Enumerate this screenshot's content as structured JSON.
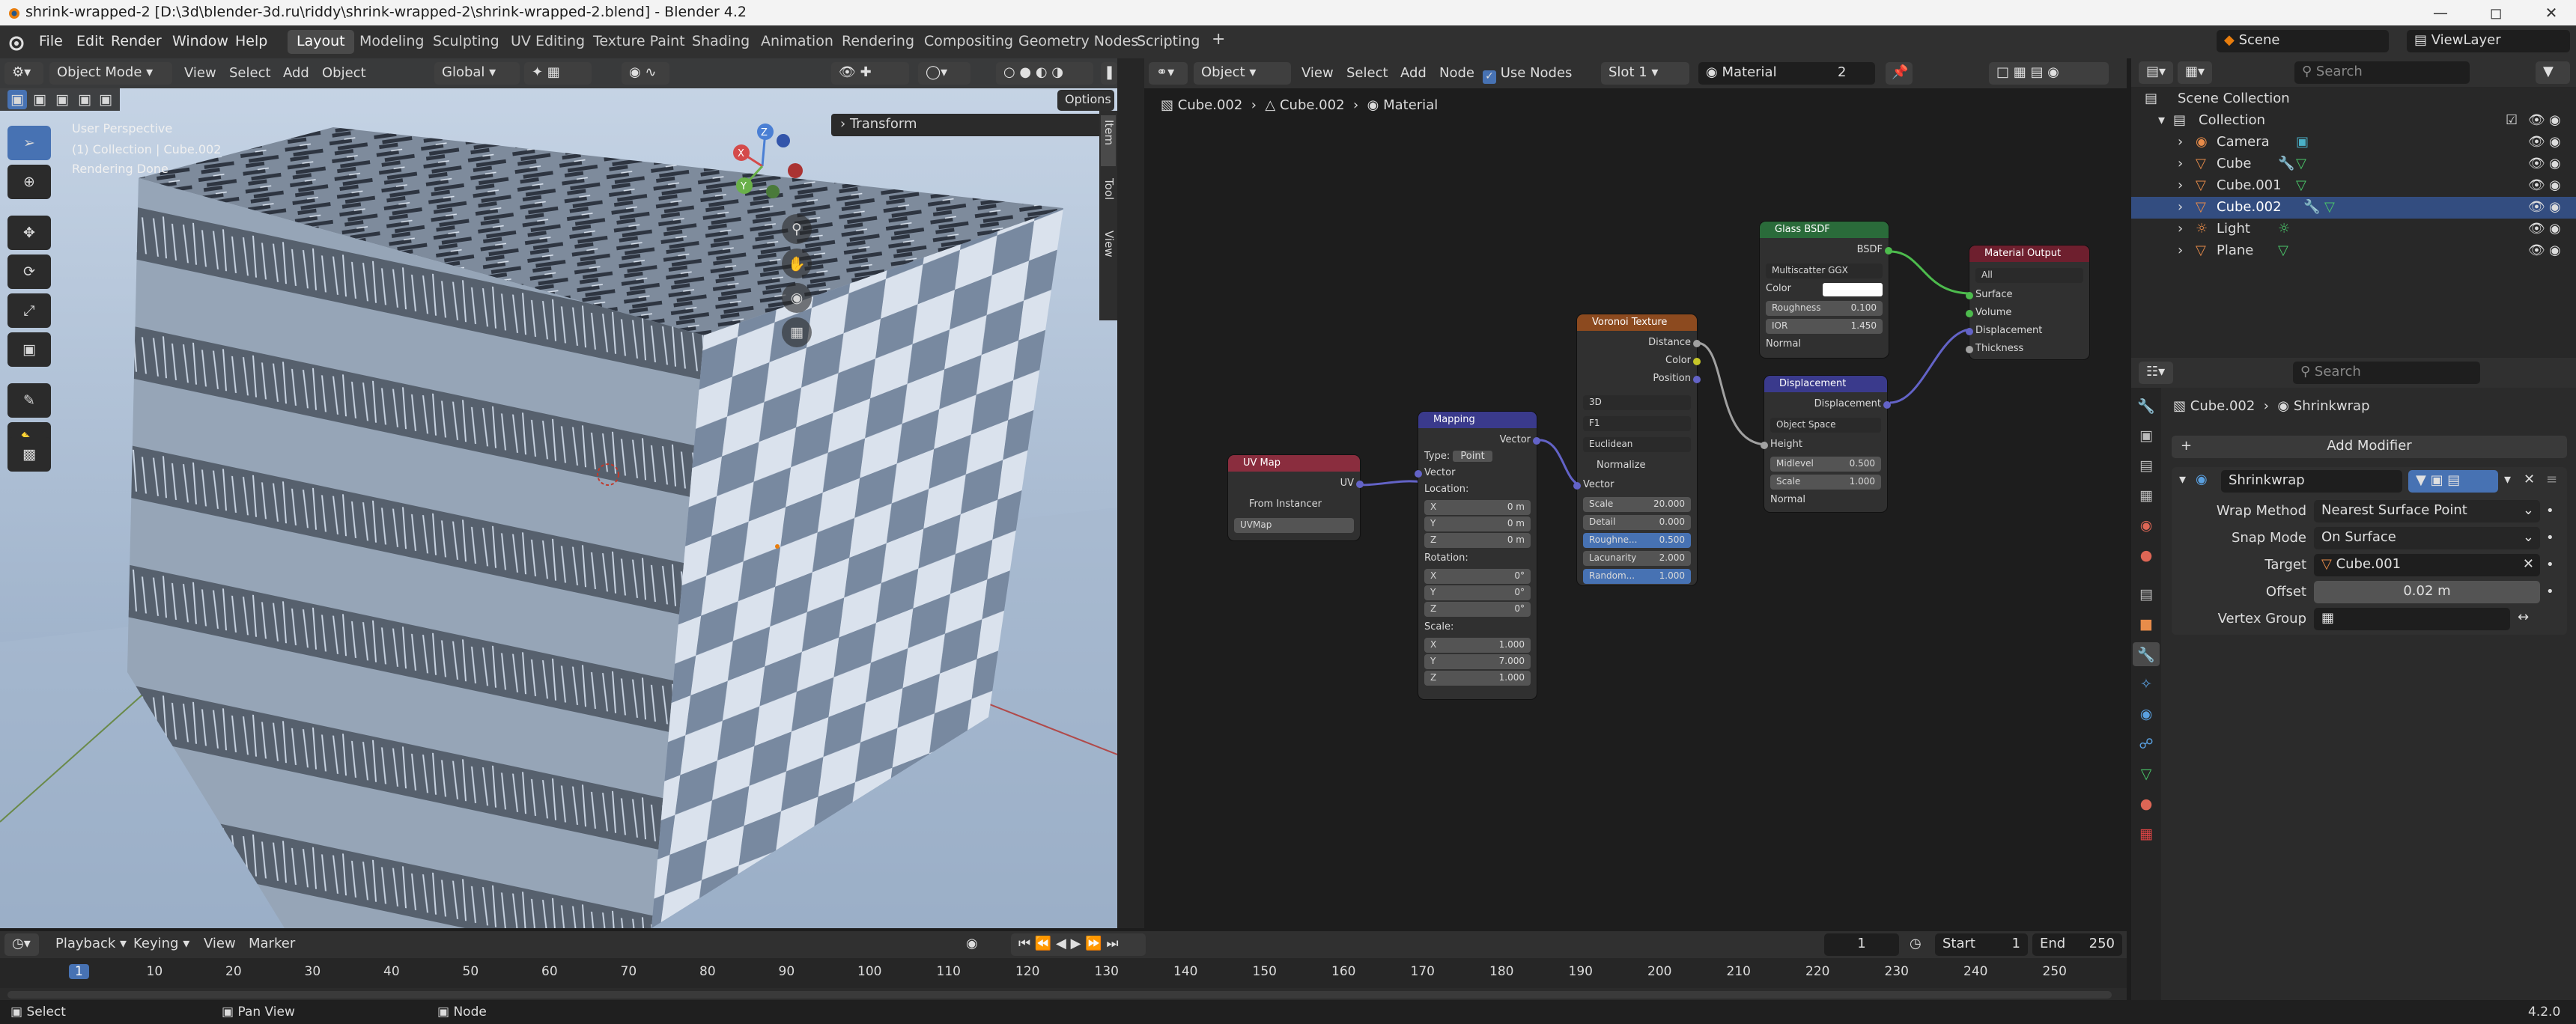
{
  "title": "shrink-wrapped-2 [D:\\3d\\blender-3d.ru\\riddy\\shrink-wrapped-2\\shrink-wrapped-2.blend] - Blender 4.2",
  "menus": [
    "File",
    "Edit",
    "Render",
    "Window",
    "Help"
  ],
  "workspaces": [
    "Layout",
    "Modeling",
    "Sculpting",
    "UV Editing",
    "Texture Paint",
    "Shading",
    "Animation",
    "Rendering",
    "Compositing",
    "Geometry Nodes",
    "Scripting"
  ],
  "scene": "Scene",
  "view_layer": "ViewLayer",
  "viewport": {
    "mode": "Object Mode",
    "menus": [
      "View",
      "Select",
      "Add",
      "Object"
    ],
    "orientation": "Global",
    "options": "Options",
    "transform": "Transform",
    "overlay_lines": [
      "User Perspective",
      "(1) Collection | Cube.002",
      "Rendering Done"
    ],
    "side_tabs": [
      "Item",
      "Tool",
      "View"
    ],
    "gizmo": {
      "x": "X",
      "y": "Y",
      "z": "Z"
    }
  },
  "node_editor": {
    "type": "Object",
    "menus": [
      "View",
      "Select",
      "Add",
      "Node"
    ],
    "use_nodes": "Use Nodes",
    "slot": "Slot 1",
    "material": "Material",
    "users": "2",
    "breadcrumb": [
      "Cube.002",
      "Cube.002",
      "Material"
    ],
    "nodes": {
      "uvmap": {
        "title": "UV Map",
        "out": "UV",
        "from_instancer": "From Instancer",
        "uvmap": "UVMap"
      },
      "mapping": {
        "title": "Mapping",
        "out": "Vector",
        "type_label": "Type:",
        "type": "Point",
        "vector": "Vector",
        "location": "Location:",
        "loc": [
          [
            "X",
            "0 m"
          ],
          [
            "Y",
            "0 m"
          ],
          [
            "Z",
            "0 m"
          ]
        ],
        "rotation": "Rotation:",
        "rot": [
          [
            "X",
            "0°"
          ],
          [
            "Y",
            "0°"
          ],
          [
            "Z",
            "0°"
          ]
        ],
        "scale": "Scale:",
        "scl": [
          [
            "X",
            "1.000"
          ],
          [
            "Y",
            "7.000"
          ],
          [
            "Z",
            "1.000"
          ]
        ]
      },
      "voronoi": {
        "title": "Voronoi Texture",
        "outs": [
          "Distance",
          "Color",
          "Position"
        ],
        "dim": "3D",
        "feature": "F1",
        "metric": "Euclidean",
        "normalize": "Normalize",
        "vector": "Vector",
        "fields": [
          [
            "Scale",
            "20.000"
          ],
          [
            "Detail",
            "0.000"
          ],
          [
            "Roughne...",
            "0.500"
          ],
          [
            "Lacunarity",
            "2.000"
          ],
          [
            "Random...",
            "1.000"
          ]
        ]
      },
      "glass": {
        "title": "Glass BSDF",
        "out": "BSDF",
        "dist": "Multiscatter GGX",
        "color": "Color",
        "roughness": [
          "Roughness",
          "0.100"
        ],
        "ior": [
          "IOR",
          "1.450"
        ],
        "normal": "Normal"
      },
      "disp": {
        "title": "Displacement",
        "out": "Displacement",
        "space": "Object Space",
        "height": "Height",
        "midlevel": [
          "Midlevel",
          "0.500"
        ],
        "scale": [
          "Scale",
          "1.000"
        ],
        "normal": "Normal"
      },
      "output": {
        "title": "Material Output",
        "target": "All",
        "ins": [
          "Surface",
          "Volume",
          "Displacement",
          "Thickness"
        ]
      }
    },
    "colors": {
      "uvmap": "#8a2d3e",
      "mapping": "#3a3a8c",
      "voronoi": "#8c4a1f",
      "glass": "#2a6b3a",
      "disp": "#3a3a8c",
      "output": "#6e1f2e"
    }
  },
  "outliner": {
    "search": "Search",
    "rows": [
      "Scene Collection",
      "Collection",
      "Camera",
      "Cube",
      "Cube.001",
      "Cube.002",
      "Light",
      "Plane"
    ]
  },
  "properties": {
    "search": "Search",
    "breadcrumb": [
      "Cube.002",
      "Shrinkwrap"
    ],
    "add_modifier": "Add Modifier",
    "modifier": "Shrinkwrap",
    "fields": [
      [
        "Wrap Method",
        "Nearest Surface Point"
      ],
      [
        "Snap Mode",
        "On Surface"
      ],
      [
        "Target",
        "Cube.001"
      ],
      [
        "Offset",
        "0.02 m"
      ],
      [
        "Vertex Group",
        ""
      ]
    ]
  },
  "timeline": {
    "menus": [
      "Playback",
      "Keying",
      "View",
      "Marker"
    ],
    "frame": "1",
    "start_label": "Start",
    "start": "1",
    "end_label": "End",
    "end": "250",
    "ticks": [
      "1",
      "10",
      "20",
      "30",
      "40",
      "50",
      "60",
      "70",
      "80",
      "90",
      "100",
      "110",
      "120",
      "130",
      "140",
      "150",
      "160",
      "170",
      "180",
      "190",
      "200",
      "210",
      "220",
      "230",
      "240",
      "250"
    ]
  },
  "status": {
    "items": [
      "Select",
      "Pan View",
      "Node"
    ],
    "version": "4.2.0"
  }
}
